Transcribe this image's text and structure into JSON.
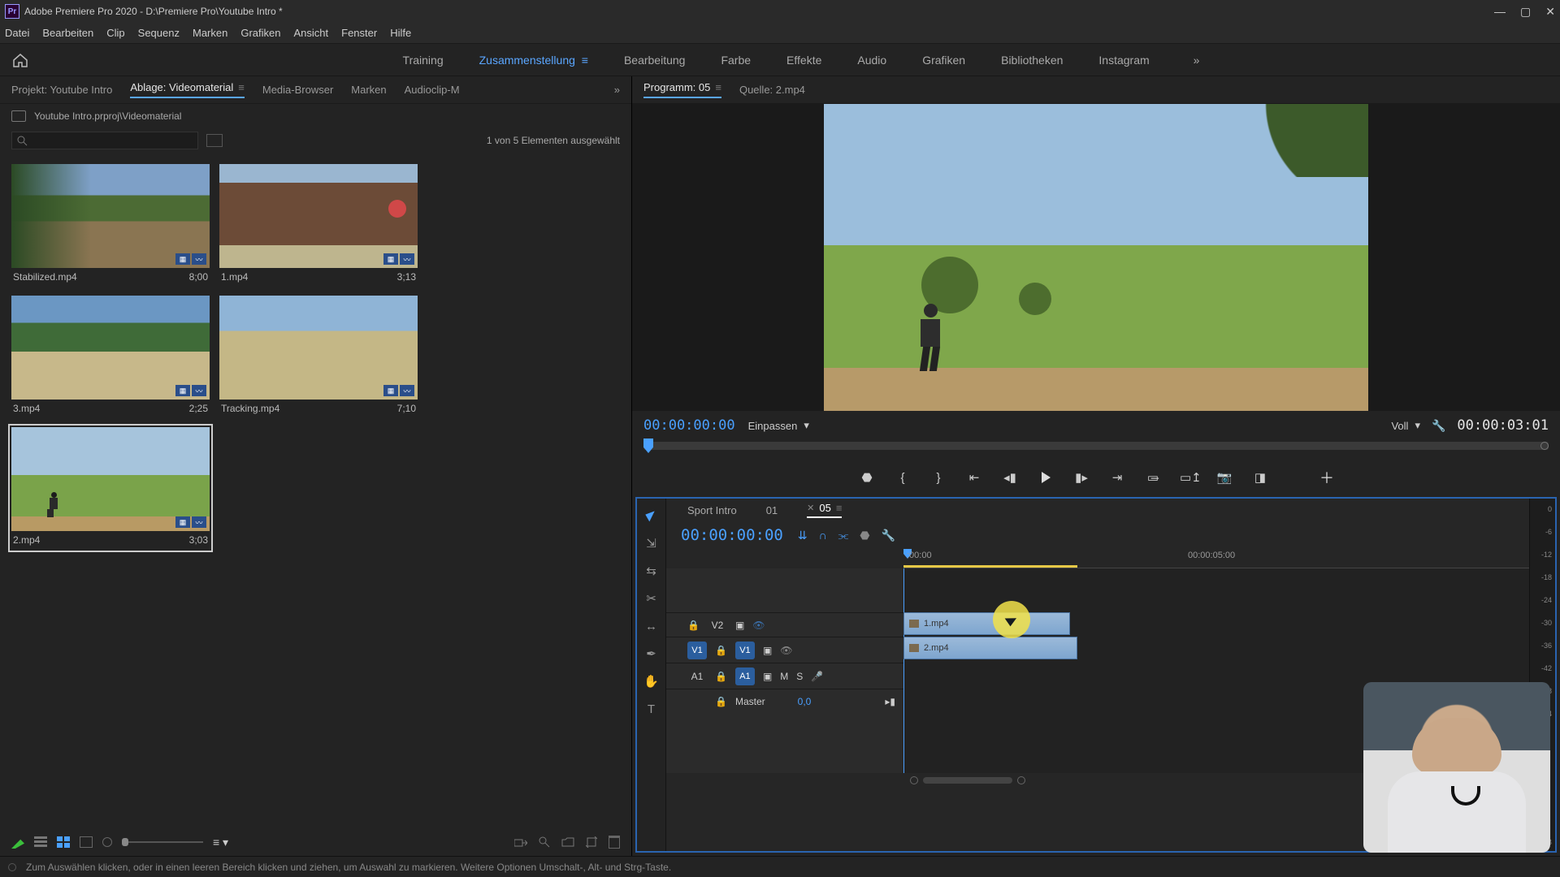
{
  "title_bar": {
    "app_title": "Adobe Premiere Pro 2020 - D:\\Premiere Pro\\Youtube Intro *"
  },
  "menu": {
    "datei": "Datei",
    "bearbeiten": "Bearbeiten",
    "clip": "Clip",
    "sequenz": "Sequenz",
    "marken": "Marken",
    "grafiken": "Grafiken",
    "ansicht": "Ansicht",
    "fenster": "Fenster",
    "hilfe": "Hilfe"
  },
  "workspace": {
    "training": "Training",
    "zusammenstellung": "Zusammenstellung",
    "bearbeitung": "Bearbeitung",
    "farbe": "Farbe",
    "effekte": "Effekte",
    "audio": "Audio",
    "grafiken": "Grafiken",
    "bibliotheken": "Bibliotheken",
    "instagram": "Instagram"
  },
  "project_tabs": {
    "projekt": "Projekt: Youtube Intro",
    "ablage": "Ablage: Videomaterial",
    "media_browser": "Media-Browser",
    "marken": "Marken",
    "audioclip": "Audioclip-M"
  },
  "bin": {
    "path": "Youtube Intro.prproj\\Videomaterial",
    "selection_text": "1 von 5 Elementen ausgewählt"
  },
  "clips": [
    {
      "name": "Stabilized.mp4",
      "dur": "8;00"
    },
    {
      "name": "1.mp4",
      "dur": "3;13"
    },
    {
      "name": "3.mp4",
      "dur": "2;25"
    },
    {
      "name": "Tracking.mp4",
      "dur": "7;10"
    },
    {
      "name": "2.mp4",
      "dur": "3;03"
    }
  ],
  "program_tabs": {
    "programm": "Programm: 05",
    "quelle": "Quelle: 2.mp4"
  },
  "monitor": {
    "tc_in": "00:00:00:00",
    "fit": "Einpassen",
    "scale": "Voll",
    "tc_out": "00:00:03:01"
  },
  "timeline": {
    "tabs": {
      "a": "Sport Intro",
      "b": "01",
      "c": "05"
    },
    "tc": "00:00:00:00",
    "ruler": {
      "t0": ":00:00",
      "t1": "00:00:05:00"
    },
    "tracks": {
      "v2": "V2",
      "v1src": "V1",
      "v1": "V1",
      "a1src": "A1",
      "a1": "A1",
      "m": "M",
      "s": "S",
      "master": "Master",
      "master_val": "0,0"
    },
    "clips": {
      "c1": "1.mp4",
      "c2": "2.mp4"
    }
  },
  "audio_meter_labels": [
    "0",
    "-6",
    "-12",
    "-18",
    "-24",
    "-30",
    "-36",
    "-42",
    "-48",
    "-54",
    "dB"
  ],
  "status": {
    "text": "Zum Auswählen klicken, oder in einen leeren Bereich klicken und ziehen, um Auswahl zu markieren. Weitere Optionen Umschalt-, Alt- und Strg-Taste."
  }
}
